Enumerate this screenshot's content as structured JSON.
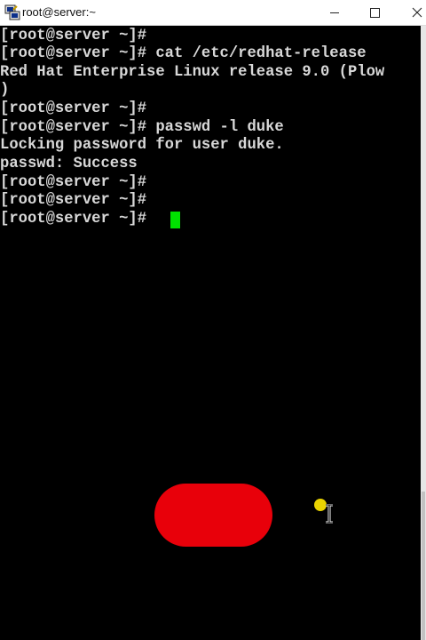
{
  "window": {
    "title": "root@server:~",
    "minimize_icon": "minimize-icon",
    "maximize_icon": "maximize-icon",
    "close_icon": "close-icon"
  },
  "terminal": {
    "lines": [
      "[root@server ~]#",
      "[root@server ~]# cat /etc/redhat-release",
      "Red Hat Enterprise Linux release 9.0 (Plow",
      ")",
      "[root@server ~]#",
      "[root@server ~]# passwd -l duke",
      "Locking password for user duke.",
      "passwd: Success",
      "[root@server ~]#",
      "[root@server ~]#",
      "[root@server ~]#"
    ],
    "text_color": "#d8d8d8",
    "background": "#000000",
    "cursor_color": "#00e000"
  },
  "overlay": {
    "record_button_color": "#e8000a",
    "pointer_color": "#e9d300",
    "pointer_icon": "text-cursor-icon"
  }
}
